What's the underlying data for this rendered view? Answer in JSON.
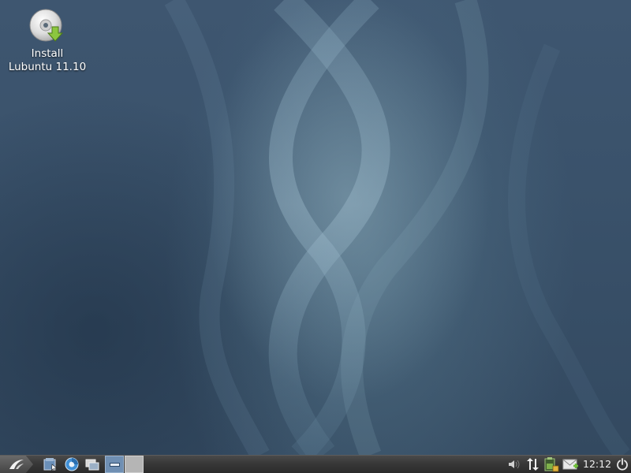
{
  "desktop": {
    "icons": [
      {
        "label_line1": "Install",
        "label_line2": "Lubuntu 11.10",
        "icon": "install-disc-icon"
      }
    ]
  },
  "panel": {
    "launchers": [
      "file-manager-icon",
      "web-browser-icon",
      "show-desktop-icon"
    ],
    "workspaces": [
      "workspace-1",
      "workspace-2"
    ],
    "tray": [
      "volume-icon",
      "network-icon",
      "battery-icon",
      "mail-icon"
    ],
    "clock": "12:12",
    "shutdown_icon": "power-icon"
  },
  "colors": {
    "panel": "#333333",
    "desktop": "#3a526b",
    "active_workspace": "#6f8fb3"
  }
}
